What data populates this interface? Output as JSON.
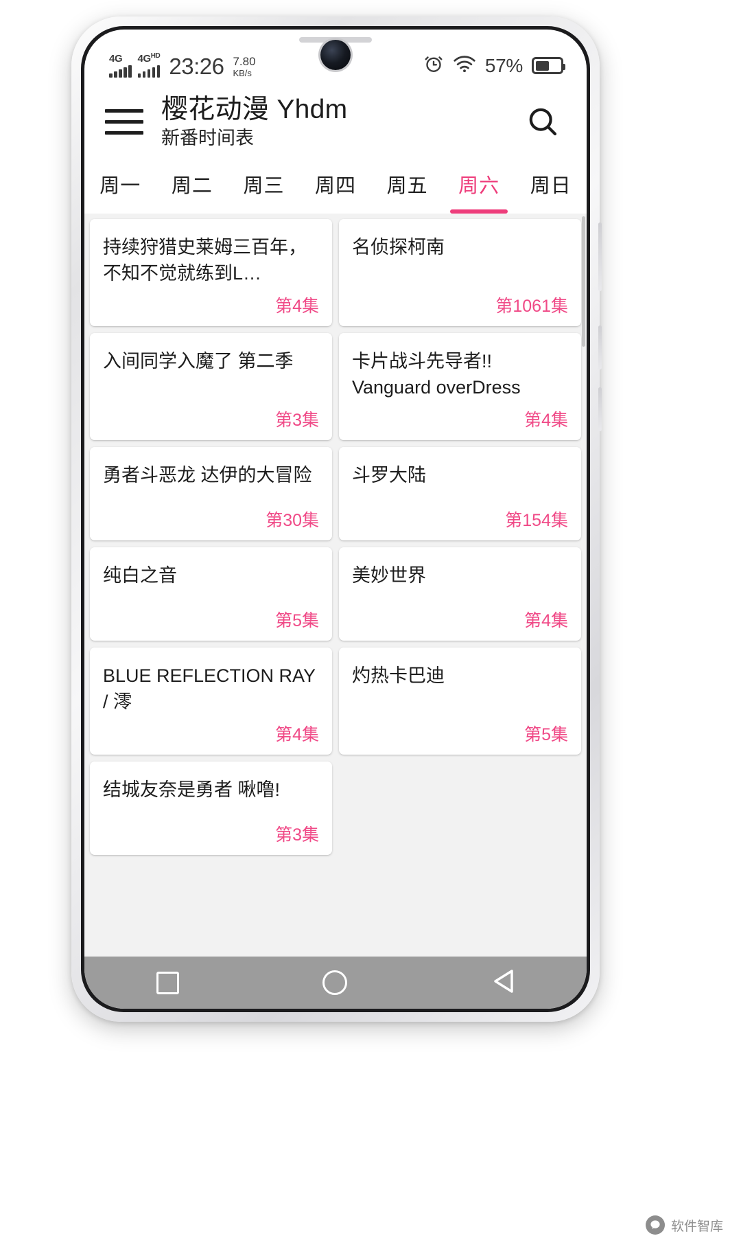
{
  "status_bar": {
    "network_1": "4G",
    "network_2": "4G",
    "network_2_sup": "HD",
    "time": "23:26",
    "net_speed_value": "7.80",
    "net_speed_unit": "KB/s",
    "alarm_icon": "alarm-clock-icon",
    "wifi_icon": "wifi-icon",
    "battery_percent": "57%"
  },
  "app_bar": {
    "menu_icon": "hamburger-menu-icon",
    "title": "樱花动漫 Yhdm",
    "subtitle": "新番时间表",
    "search_icon": "search-icon"
  },
  "tabs": {
    "items": [
      {
        "label": "周一",
        "active": false
      },
      {
        "label": "周二",
        "active": false
      },
      {
        "label": "周三",
        "active": false
      },
      {
        "label": "周四",
        "active": false
      },
      {
        "label": "周五",
        "active": false
      },
      {
        "label": "周六",
        "active": true
      },
      {
        "label": "周日",
        "active": false
      }
    ],
    "active_index": 5,
    "active_color": "#ee3d7b"
  },
  "schedule": {
    "accent_color": "#f04a87",
    "cards": [
      {
        "title": "持续狩猎史莱姆三百年，不知不觉就练到L…",
        "episode": "第4集"
      },
      {
        "title": "名侦探柯南",
        "episode": "第1061集"
      },
      {
        "title": "入间同学入魔了 第二季",
        "episode": "第3集"
      },
      {
        "title": "卡片战斗先导者!! Vanguard overDress",
        "episode": "第4集"
      },
      {
        "title": "勇者斗恶龙 达伊的大冒险",
        "episode": "第30集"
      },
      {
        "title": "斗罗大陆",
        "episode": "第154集"
      },
      {
        "title": "纯白之音",
        "episode": "第5集"
      },
      {
        "title": "美妙世界",
        "episode": "第4集"
      },
      {
        "title": "BLUE REFLECTION RAY / 澪",
        "episode": "第4集"
      },
      {
        "title": "灼热卡巴迪",
        "episode": "第5集"
      },
      {
        "title": "结城友奈是勇者 啾噜!",
        "episode": "第3集"
      }
    ]
  },
  "nav_bar": {
    "recents_icon": "square-recents-icon",
    "home_icon": "circle-home-icon",
    "back_icon": "triangle-back-icon",
    "background_color": "#9c9c9c"
  },
  "watermark": {
    "label": "软件智库"
  }
}
